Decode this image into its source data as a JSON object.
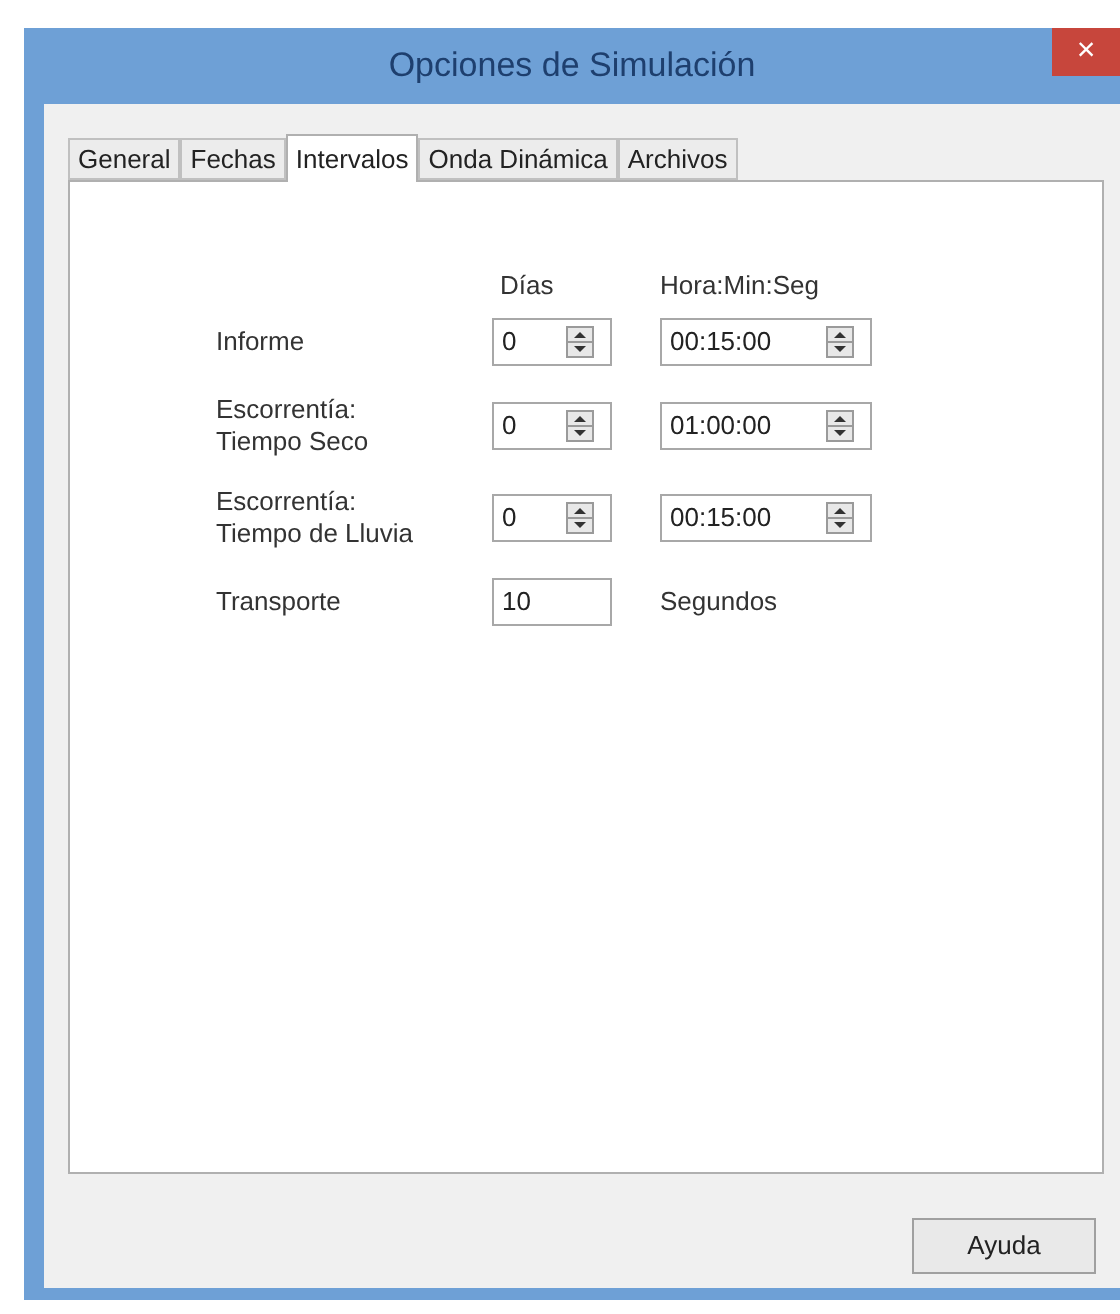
{
  "window": {
    "title": "Opciones de Simulación",
    "close": "×"
  },
  "tabs": [
    {
      "label": "General",
      "selected": false
    },
    {
      "label": "Fechas",
      "selected": false
    },
    {
      "label": "Intervalos",
      "selected": true
    },
    {
      "label": "Onda Dinámica",
      "selected": false
    },
    {
      "label": "Archivos",
      "selected": false
    }
  ],
  "headers": [
    "Días",
    "Hora:Min:Seg"
  ],
  "rows": [
    {
      "kind": "spinners",
      "label": [
        "Informe"
      ],
      "days": "0",
      "time": "00:15:00"
    },
    {
      "kind": "spinners",
      "label": [
        "Escorrentía:",
        "Tiempo Seco"
      ],
      "days": "0",
      "time": "01:00:00"
    },
    {
      "kind": "spinners",
      "label": [
        "Escorrentía:",
        "Tiempo de Lluvia"
      ],
      "days": "0",
      "time": "00:15:00"
    },
    {
      "kind": "field",
      "label": [
        "Transporte"
      ],
      "value": "10",
      "unit": "Segundos"
    }
  ],
  "buttons": [
    "Ayuda"
  ]
}
